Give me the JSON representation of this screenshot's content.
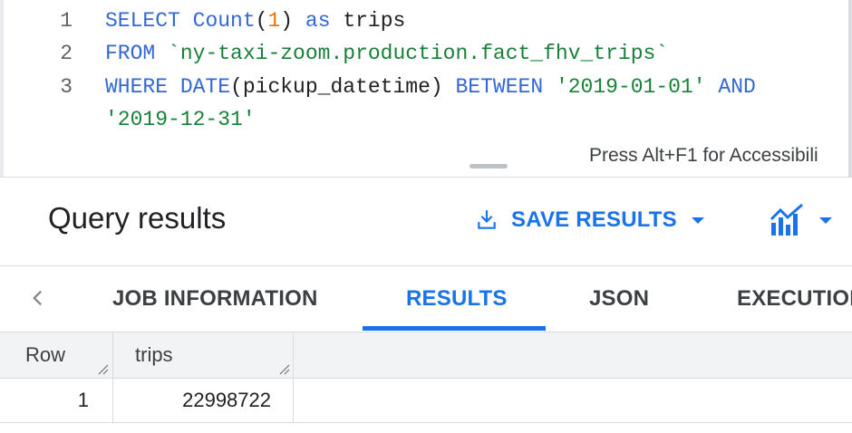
{
  "editor": {
    "line_numbers": [
      "1",
      "2",
      "3"
    ],
    "line1": {
      "kw_select": "SELECT",
      "fn_count": "Count",
      "paren_open": "(",
      "num": "1",
      "paren_close": ")",
      "kw_as": "as",
      "alias": "trips"
    },
    "line2": {
      "kw_from": "FROM",
      "table": "`ny-taxi-zoom.production.fact_fhv_trips`"
    },
    "line3": {
      "kw_where": "WHERE",
      "fn_date": "DATE",
      "arg": "(pickup_datetime)",
      "kw_between": "BETWEEN",
      "start": "'2019-01-01'",
      "kw_and": "AND"
    },
    "line3_wrap": {
      "end": "'2019-12-31'"
    },
    "accessibility_hint": "Press Alt+F1 for Accessibili"
  },
  "results": {
    "title": "Query results",
    "save_label": "SAVE RESULTS",
    "explore_icon": "chart-icon"
  },
  "tabs": [
    "JOB INFORMATION",
    "RESULTS",
    "JSON",
    "EXECUTIOI"
  ],
  "active_tab": "RESULTS",
  "table": {
    "headers": [
      "Row",
      "trips"
    ],
    "rows": [
      [
        "1",
        "22998722"
      ]
    ]
  },
  "colors": {
    "accent": "#1a73e8",
    "keyword": "#3367d6",
    "string": "#188038",
    "number": "#e8710a"
  }
}
